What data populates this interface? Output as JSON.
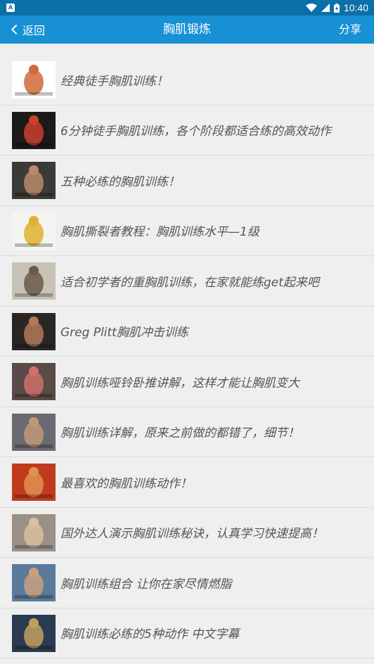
{
  "status": {
    "time": "10:40",
    "app_icon": "A"
  },
  "appbar": {
    "back": "返回",
    "title": "胸肌锻炼",
    "share": "分享"
  },
  "items": [
    {
      "title": "经典徒手胸肌训练！",
      "thumb": {
        "bg": "#ffffff",
        "accent": "#d06a3a"
      }
    },
    {
      "title": "6分钟徒手胸肌训练，各个阶段都适合练的高效动作",
      "thumb": {
        "bg": "#1c1a18",
        "accent": "#c9402e"
      }
    },
    {
      "title": "五种必练的胸肌训练！",
      "thumb": {
        "bg": "#3c3a36",
        "accent": "#b98a6a"
      }
    },
    {
      "title": "胸肌撕裂者教程：胸肌训练水平—1级",
      "thumb": {
        "bg": "#f4f4f0",
        "accent": "#e0b030"
      }
    },
    {
      "title": "适合初学者的重胸肌训练，在家就能练get起来吧",
      "thumb": {
        "bg": "#c8c2b6",
        "accent": "#6a5a4a"
      }
    },
    {
      "title": "Greg Plitt胸肌冲击训练",
      "thumb": {
        "bg": "#2a2624",
        "accent": "#b07a5a"
      }
    },
    {
      "title": "胸肌训练哑铃卧推讲解，这样才能让胸肌变大",
      "thumb": {
        "bg": "#5a4a48",
        "accent": "#d0706a"
      }
    },
    {
      "title": "胸肌训练详解，原来之前做的都错了，细节！",
      "thumb": {
        "bg": "#6a6a70",
        "accent": "#c09878"
      }
    },
    {
      "title": "最喜欢的胸肌训练动作！",
      "thumb": {
        "bg": "#c03a1e",
        "accent": "#e09050"
      }
    },
    {
      "title": "国外达人演示胸肌训练秘诀，认真学习快速提高！",
      "thumb": {
        "bg": "#9a9088",
        "accent": "#d8c0a0"
      }
    },
    {
      "title": "胸肌训练组合 让你在家尽情燃脂",
      "thumb": {
        "bg": "#5a7a9a",
        "accent": "#c8a080"
      }
    },
    {
      "title": "胸肌训练必练的5种动作 中文字幕",
      "thumb": {
        "bg": "#2a3a50",
        "accent": "#c0a060"
      }
    }
  ]
}
